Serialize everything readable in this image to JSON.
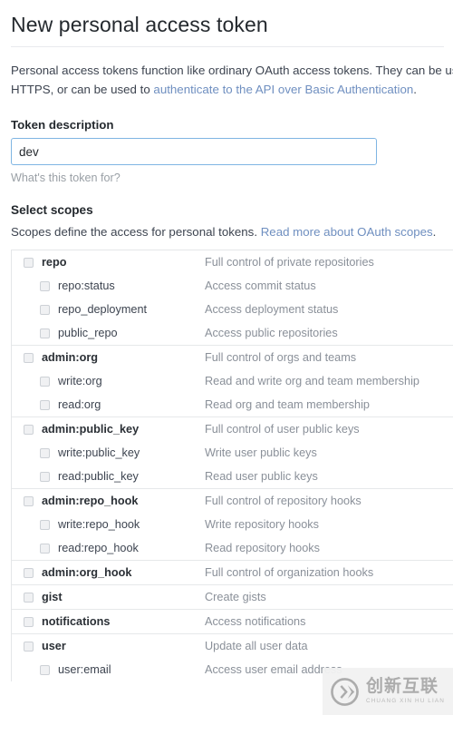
{
  "header": {
    "title": "New personal access token"
  },
  "intro": {
    "line1_before": "Personal access tokens function like ordinary OAuth access tokens. They can be used",
    "line2_before": "HTTPS, or can be used to ",
    "line2_link": "authenticate to the API over Basic Authentication",
    "line2_after": "."
  },
  "token_description": {
    "label": "Token description",
    "value": "dev",
    "placeholder": "",
    "helper": "What's this token for?"
  },
  "scopes_section": {
    "heading": "Select scopes",
    "sub_before": "Scopes define the access for personal tokens. ",
    "sub_link": "Read more about OAuth scopes",
    "sub_after": "."
  },
  "scope_groups": [
    {
      "rows": [
        {
          "level": "parent",
          "name": "repo",
          "desc": "Full control of private repositories",
          "checked": false
        },
        {
          "level": "child",
          "name": "repo:status",
          "desc": "Access commit status",
          "checked": false
        },
        {
          "level": "child",
          "name": "repo_deployment",
          "desc": "Access deployment status",
          "checked": false
        },
        {
          "level": "child",
          "name": "public_repo",
          "desc": "Access public repositories",
          "checked": false
        }
      ]
    },
    {
      "rows": [
        {
          "level": "parent",
          "name": "admin:org",
          "desc": "Full control of orgs and teams",
          "checked": false
        },
        {
          "level": "child",
          "name": "write:org",
          "desc": "Read and write org and team membership",
          "checked": false
        },
        {
          "level": "child",
          "name": "read:org",
          "desc": "Read org and team membership",
          "checked": false
        }
      ]
    },
    {
      "rows": [
        {
          "level": "parent",
          "name": "admin:public_key",
          "desc": "Full control of user public keys",
          "checked": false
        },
        {
          "level": "child",
          "name": "write:public_key",
          "desc": "Write user public keys",
          "checked": false
        },
        {
          "level": "child",
          "name": "read:public_key",
          "desc": "Read user public keys",
          "checked": false
        }
      ]
    },
    {
      "rows": [
        {
          "level": "parent",
          "name": "admin:repo_hook",
          "desc": "Full control of repository hooks",
          "checked": false
        },
        {
          "level": "child",
          "name": "write:repo_hook",
          "desc": "Write repository hooks",
          "checked": false
        },
        {
          "level": "child",
          "name": "read:repo_hook",
          "desc": "Read repository hooks",
          "checked": false
        }
      ]
    },
    {
      "rows": [
        {
          "level": "parent",
          "name": "admin:org_hook",
          "desc": "Full control of organization hooks",
          "checked": false
        }
      ]
    },
    {
      "rows": [
        {
          "level": "parent",
          "name": "gist",
          "desc": "Create gists",
          "checked": false
        }
      ]
    },
    {
      "rows": [
        {
          "level": "parent",
          "name": "notifications",
          "desc": "Access notifications",
          "checked": false
        }
      ]
    },
    {
      "rows": [
        {
          "level": "parent",
          "name": "user",
          "desc": "Update all user data",
          "checked": false
        },
        {
          "level": "child",
          "name": "user:email",
          "desc": "Access user email address",
          "checked": false
        }
      ]
    }
  ],
  "watermark": {
    "logo_letters": "CX",
    "chinese": "创新互联",
    "pinyin": "CHUANG XIN HU LIAN"
  },
  "colors": {
    "link": "#6f8fc0",
    "input_focus_border": "#7fb5e3",
    "text": "#24292e",
    "muted": "#8a9099"
  }
}
